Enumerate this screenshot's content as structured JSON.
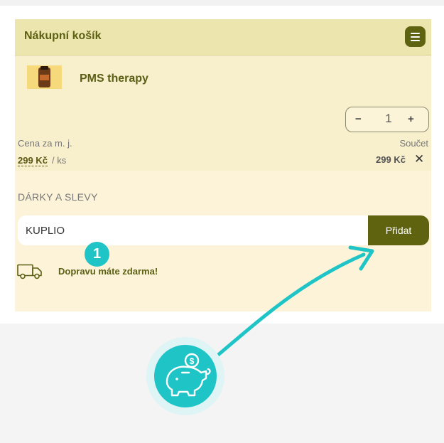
{
  "cart": {
    "title": "Nákupní košík",
    "menu_icon": "hamburger-menu-icon",
    "accent_color": "#5f6310",
    "item": {
      "name": "PMS therapy",
      "image": "product-bottle-image",
      "quantity": "1",
      "minus_symbol": "−",
      "plus_symbol": "+",
      "unit_price_label": "Cena za m. j.",
      "total_label": "Součet",
      "unit_price": "299 Kč",
      "unit_suffix": "/ ks",
      "total_price": "299 Kč",
      "remove_symbol": "✕"
    },
    "gifts": {
      "title": "DÁRKY A SLEVY",
      "coupon_value": "KUPLIO",
      "add_label": "Přidat"
    },
    "shipping": {
      "icon": "truck-icon",
      "text": "Dopravu máte zdarma!"
    }
  },
  "annotation": {
    "step_number": "1",
    "step_color": "#1fc4c7",
    "icon": "piggy-bank-coin-icon",
    "coin_symbol": "$"
  }
}
